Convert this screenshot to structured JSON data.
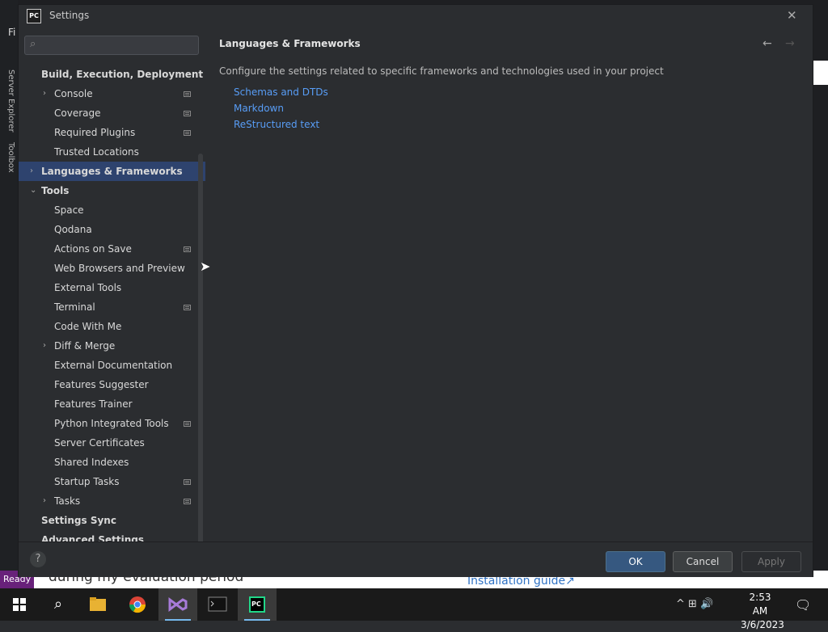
{
  "window": {
    "title": "Settings",
    "logo": "PC"
  },
  "background": {
    "menu_letter": "Fi",
    "side_tab_1": "Server Explorer",
    "side_tab_2": "Toolbox",
    "status": "Ready",
    "web_text": "during my evaluation period",
    "web_link": "Installation guide↗"
  },
  "sidebar": {
    "search_placeholder": "",
    "items": [
      {
        "label": "Build, Execution, Deployment",
        "bold": true,
        "level": 0,
        "chevron": "",
        "badge": false
      },
      {
        "label": "Console",
        "level": 1,
        "chevron": "›",
        "badge": true
      },
      {
        "label": "Coverage",
        "level": 1,
        "chevron": "",
        "badge": true
      },
      {
        "label": "Required Plugins",
        "level": 1,
        "chevron": "",
        "badge": true
      },
      {
        "label": "Trusted Locations",
        "level": 1,
        "chevron": "",
        "badge": false
      },
      {
        "label": "Languages & Frameworks",
        "bold": true,
        "level": 0,
        "chevron": "›",
        "badge": false,
        "selected": true
      },
      {
        "label": "Tools",
        "bold": true,
        "level": 0,
        "chevron": "⌄",
        "badge": false
      },
      {
        "label": "Space",
        "level": 1,
        "chevron": "",
        "badge": false
      },
      {
        "label": "Qodana",
        "level": 1,
        "chevron": "",
        "badge": false
      },
      {
        "label": "Actions on Save",
        "level": 1,
        "chevron": "",
        "badge": true
      },
      {
        "label": "Web Browsers and Preview",
        "level": 1,
        "chevron": "",
        "badge": false
      },
      {
        "label": "External Tools",
        "level": 1,
        "chevron": "",
        "badge": false
      },
      {
        "label": "Terminal",
        "level": 1,
        "chevron": "",
        "badge": true
      },
      {
        "label": "Code With Me",
        "level": 1,
        "chevron": "",
        "badge": false
      },
      {
        "label": "Diff & Merge",
        "level": 1,
        "chevron": "›",
        "badge": false
      },
      {
        "label": "External Documentation",
        "level": 1,
        "chevron": "",
        "badge": false
      },
      {
        "label": "Features Suggester",
        "level": 1,
        "chevron": "",
        "badge": false
      },
      {
        "label": "Features Trainer",
        "level": 1,
        "chevron": "",
        "badge": false
      },
      {
        "label": "Python Integrated Tools",
        "level": 1,
        "chevron": "",
        "badge": true
      },
      {
        "label": "Server Certificates",
        "level": 1,
        "chevron": "",
        "badge": false
      },
      {
        "label": "Shared Indexes",
        "level": 1,
        "chevron": "",
        "badge": false
      },
      {
        "label": "Startup Tasks",
        "level": 1,
        "chevron": "",
        "badge": true
      },
      {
        "label": "Tasks",
        "level": 1,
        "chevron": "›",
        "badge": true
      },
      {
        "label": "Settings Sync",
        "bold": true,
        "level": 0,
        "chevron": "",
        "badge": false
      },
      {
        "label": "Advanced Settings",
        "bold": true,
        "level": 0,
        "chevron": "",
        "badge": false
      }
    ]
  },
  "content": {
    "title": "Languages & Frameworks",
    "description": "Configure the settings related to specific frameworks and technologies used in your project",
    "links": [
      "Schemas and DTDs",
      "Markdown",
      "ReStructured text"
    ],
    "back": "←",
    "forward": "→"
  },
  "footer": {
    "help": "?",
    "ok": "OK",
    "cancel": "Cancel",
    "apply": "Apply"
  },
  "taskbar": {
    "time": "2:53 AM",
    "date": "3/6/2023",
    "tray": "^ ⊞ 🔊"
  },
  "colors": {
    "selection": "#2e436e",
    "link": "#589df6",
    "accent": "#365880"
  }
}
